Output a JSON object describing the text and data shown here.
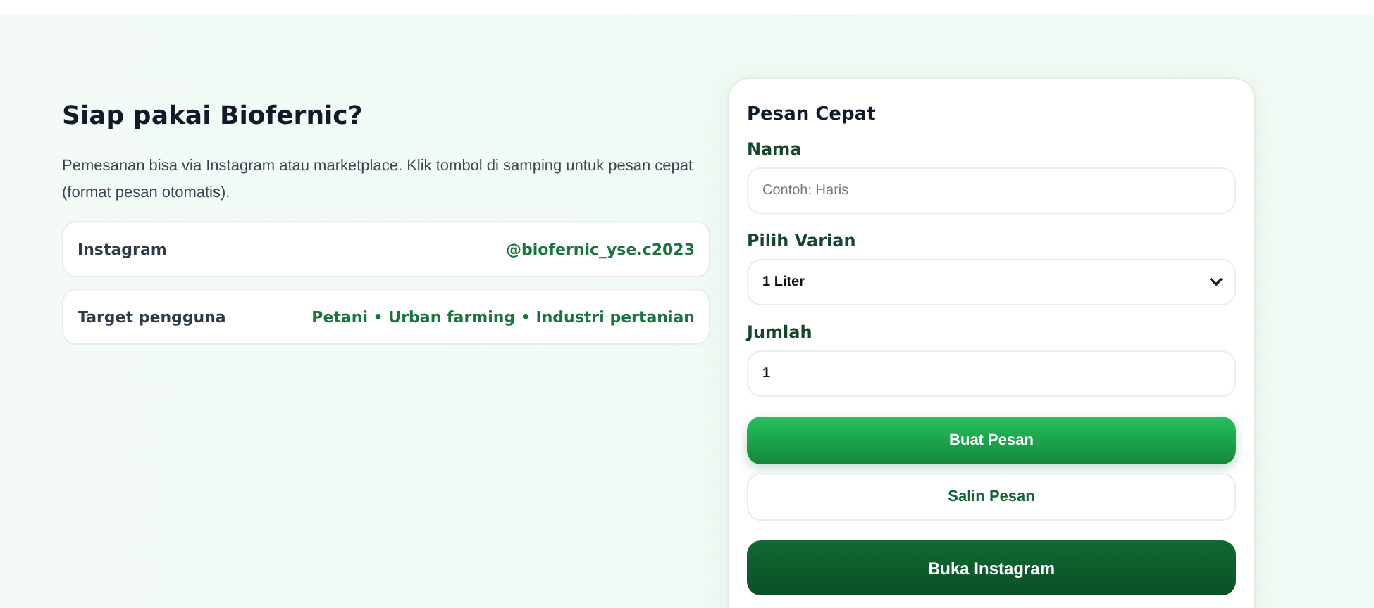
{
  "info": {
    "title": "Siap pakai Biofernic?",
    "description": "Pemesanan bisa via Instagram atau marketplace. Klik tombol di samping untuk pesan cepat (format pesan otomatis).",
    "rows": [
      {
        "label": "Instagram",
        "value": "@biofernic_yse.c2023"
      },
      {
        "label": "Target pengguna",
        "value": "Petani • Urban farming • Industri pertanian"
      }
    ]
  },
  "order_form": {
    "title": "Pesan Cepat",
    "fields": [
      {
        "kind": "text",
        "label": "Nama",
        "placeholder": "Contoh: Haris"
      },
      {
        "kind": "select",
        "label": "Pilih Varian",
        "value": "1 Liter"
      },
      {
        "kind": "text",
        "label": "Jumlah",
        "value": "1"
      }
    ],
    "buttons": [
      {
        "kind": "primary",
        "label": "Buat Pesan"
      },
      {
        "kind": "secondary",
        "label": "Salin Pesan"
      },
      {
        "kind": "dark",
        "label": "Buka Instagram"
      }
    ]
  }
}
